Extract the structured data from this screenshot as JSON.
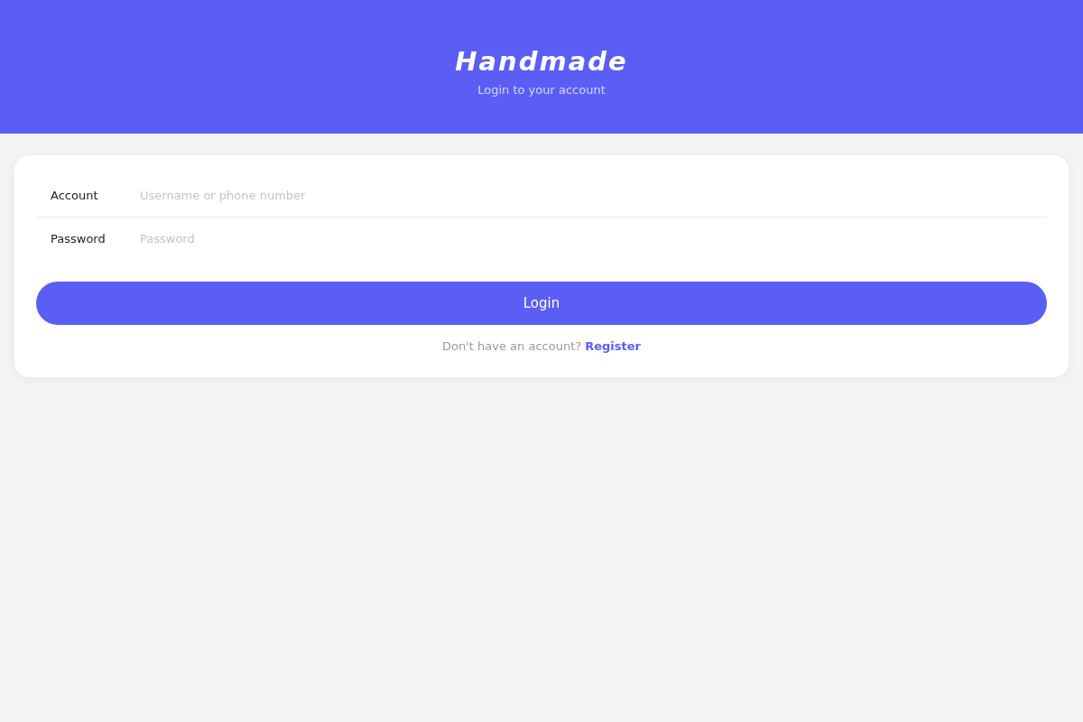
{
  "header": {
    "title": "Handmade",
    "subtitle": "Login to your account"
  },
  "form": {
    "fields": [
      {
        "label": "Account",
        "placeholder": "Username or phone number"
      },
      {
        "label": "Password",
        "placeholder": "Password"
      }
    ],
    "submit_button": "Login",
    "footer": {
      "prompt": "Don't have an account?",
      "link": "Register"
    }
  }
}
